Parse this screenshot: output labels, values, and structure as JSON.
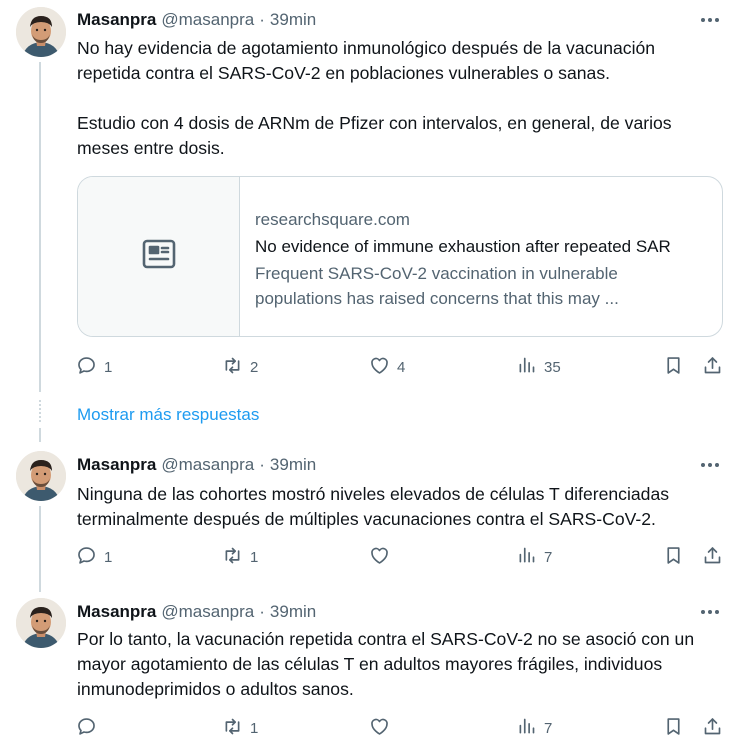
{
  "tweets": [
    {
      "name": "Masanpra",
      "handle": "@masanpra",
      "separator": "·",
      "time": "39min",
      "text": "No hay evidencia de agotamiento inmunológico después de la vacunación repetida contra el SARS-CoV-2 en poblaciones vulnerables o sanas.\n\nEstudio con 4 dosis de ARNm de Pfizer con intervalos, en general, de varios meses entre dosis.",
      "card": {
        "domain": "researchsquare.com",
        "title": "No evidence of immune exhaustion after repeated SAR",
        "description": "Frequent SARS-CoV-2 vaccination in vulnerable populations has raised concerns that this may ..."
      },
      "replies": "1",
      "retweets": "2",
      "likes": "4",
      "views": "35"
    },
    {
      "name": "Masanpra",
      "handle": "@masanpra",
      "separator": "·",
      "time": "39min",
      "text": "Ninguna de las cohortes mostró niveles elevados de células T diferenciadas terminalmente después de múltiples vacunaciones contra el SARS-CoV-2.",
      "replies": "1",
      "retweets": "1",
      "likes": "",
      "views": "7"
    },
    {
      "name": "Masanpra",
      "handle": "@masanpra",
      "separator": "·",
      "time": "39min",
      "text": "Por lo tanto, la vacunación repetida contra el SARS-CoV-2 no se asoció con un mayor agotamiento de las células T en adultos mayores frágiles, individuos inmunodeprimidos o adultos sanos.",
      "replies": "",
      "retweets": "1",
      "likes": "",
      "views": "7"
    }
  ],
  "show_more_label": "Mostrar más respuestas",
  "colors": {
    "link": "#1d9bf0",
    "secondary_text": "#536471",
    "border": "#cfd9de"
  },
  "icons": [
    "avatar",
    "more-icon",
    "article-icon",
    "reply-icon",
    "retweet-icon",
    "like-icon",
    "views-icon",
    "bookmark-icon",
    "share-icon"
  ]
}
